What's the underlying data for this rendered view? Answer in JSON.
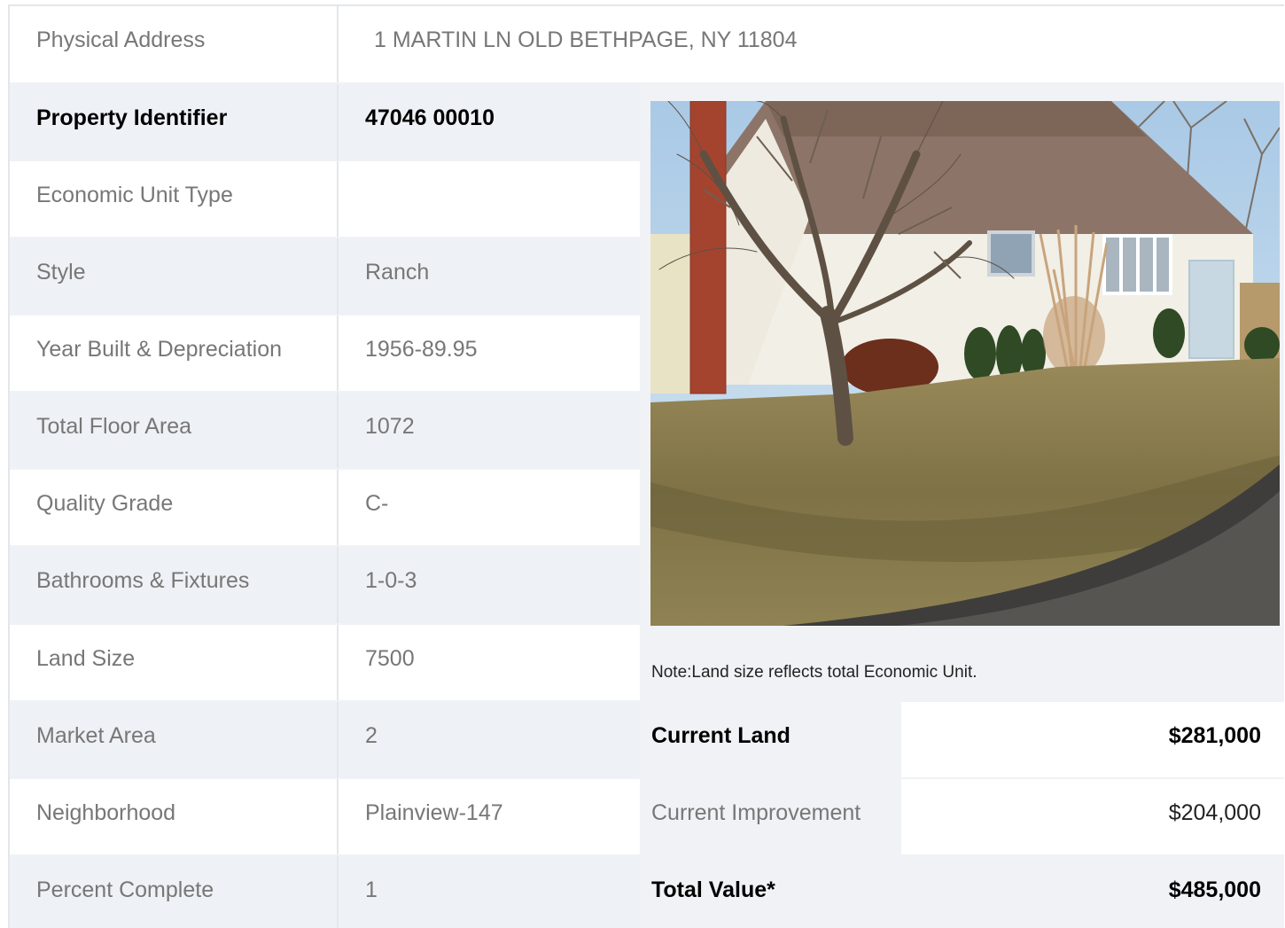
{
  "address": {
    "label": "Physical Address",
    "value": "1  MARTIN LN  OLD BETHPAGE, NY  11804"
  },
  "rows": [
    {
      "label": "Property Identifier",
      "value": "47046  00010"
    },
    {
      "label": "Economic Unit Type",
      "value": ""
    },
    {
      "label": "Style",
      "value": "Ranch"
    },
    {
      "label": "Year Built & Depreciation",
      "value": "1956-89.95"
    },
    {
      "label": "Total Floor Area",
      "value": "1072"
    },
    {
      "label": "Quality Grade",
      "value": "C-"
    },
    {
      "label": "Bathrooms & Fixtures",
      "value": "1-0-3"
    },
    {
      "label": "Land Size",
      "value": "7500"
    },
    {
      "label": "Market Area",
      "value": "2"
    },
    {
      "label": "Neighborhood",
      "value": "Plainview-147"
    },
    {
      "label": "Percent Complete",
      "value": "1"
    }
  ],
  "note": "Note:Land size reflects total Economic Unit.",
  "values": [
    {
      "label": "Current Land",
      "amount": "$281,000"
    },
    {
      "label": "Current Improvement",
      "amount": "$204,000"
    },
    {
      "label": "Total Value*",
      "amount": "$485,000"
    }
  ],
  "colors": {
    "text_muted": "#777777",
    "text_strong": "#000000",
    "row_alt": "#eef1f5",
    "border": "#e3e6ea"
  }
}
